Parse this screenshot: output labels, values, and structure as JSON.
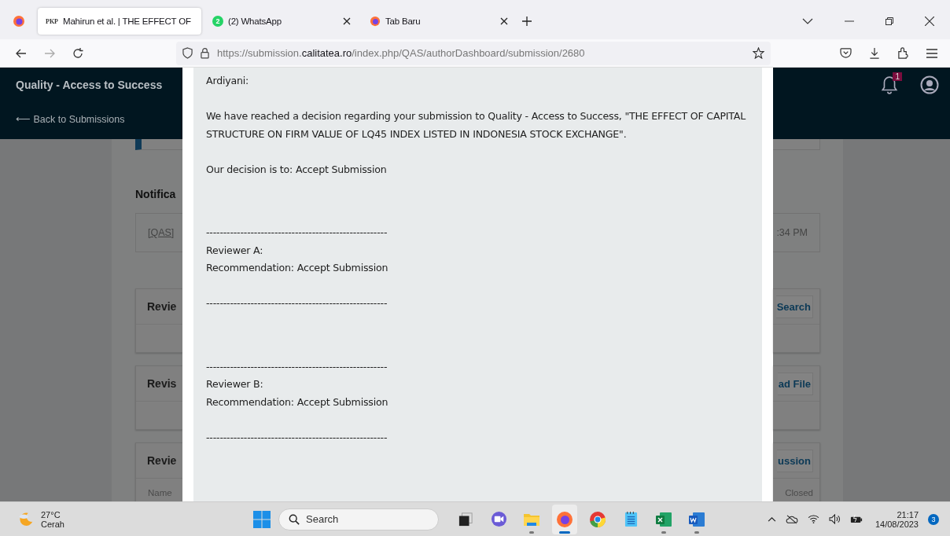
{
  "browser": {
    "tabs": [
      {
        "kind": "pkp",
        "logo": "PKP",
        "title": "Mahirun et al. | THE EFFECT OF",
        "selected": true
      },
      {
        "kind": "whatsapp",
        "title": "(2) WhatsApp",
        "badge": "2",
        "selected": false
      },
      {
        "kind": "firefox",
        "title": "Tab Baru",
        "selected": false
      }
    ],
    "url": "https://submission.**calitatea.ro**/index.php/QAS/authorDashboard/submission/2680"
  },
  "site": {
    "title": "Quality - Access to Success",
    "back_link": "⟵ Back to Submissions",
    "notification_count": "1"
  },
  "background": {
    "heading": "Notifica",
    "notification": {
      "subject": "[QAS]",
      "time": ":34 PM"
    },
    "cards": [
      {
        "title": "Revie",
        "button": "Search"
      },
      {
        "title": "Revis",
        "button": "ad File"
      },
      {
        "title": "Revie",
        "button": "ussion",
        "column_1": "Name",
        "column_2": "Closed"
      }
    ]
  },
  "modal": {
    "lines": [
      {
        "kind": "para",
        "text": "Ardiyani:"
      },
      {
        "kind": "para",
        "text": "We have reached a decision regarding your submission to Quality - Access to Success, \"THE EFFECT OF CAPITAL STRUCTURE ON FIRM VALUE OF LQ45 INDEX LISTED IN INDONESIA STOCK EXCHANGE\"."
      },
      {
        "kind": "para",
        "text": "Our decision is to: Accept Submission"
      },
      {
        "kind": "section",
        "text": "-----------------------------------------------------"
      },
      {
        "kind": "line",
        "text": "Reviewer A:"
      },
      {
        "kind": "line",
        "text": "Recommendation: Accept Submission"
      },
      {
        "kind": "para",
        "text": "-----------------------------------------------------"
      },
      {
        "kind": "section",
        "text": "-----------------------------------------------------"
      },
      {
        "kind": "line",
        "text": "Reviewer B:"
      },
      {
        "kind": "line",
        "text": "Recommendation: Accept Submission"
      },
      {
        "kind": "para",
        "text": "-----------------------------------------------------"
      }
    ]
  },
  "taskbar": {
    "weather": {
      "temperature": "27°C",
      "condition": "Cerah"
    },
    "search": {
      "placeholder": "Search"
    },
    "apps": [
      {
        "kind": "task-view",
        "running": false,
        "selected": false
      },
      {
        "kind": "video-chat",
        "running": false,
        "selected": false
      },
      {
        "kind": "folder",
        "running": true,
        "selected": false
      },
      {
        "kind": "firefox",
        "running": true,
        "selected": true
      },
      {
        "kind": "chrome",
        "running": false,
        "selected": false
      },
      {
        "kind": "notepad",
        "running": false,
        "selected": false
      },
      {
        "kind": "excel",
        "running": true,
        "selected": false
      },
      {
        "kind": "word",
        "running": true,
        "selected": false
      }
    ],
    "time": "21:17",
    "date": "14/08/2023",
    "notification_count": "3"
  }
}
